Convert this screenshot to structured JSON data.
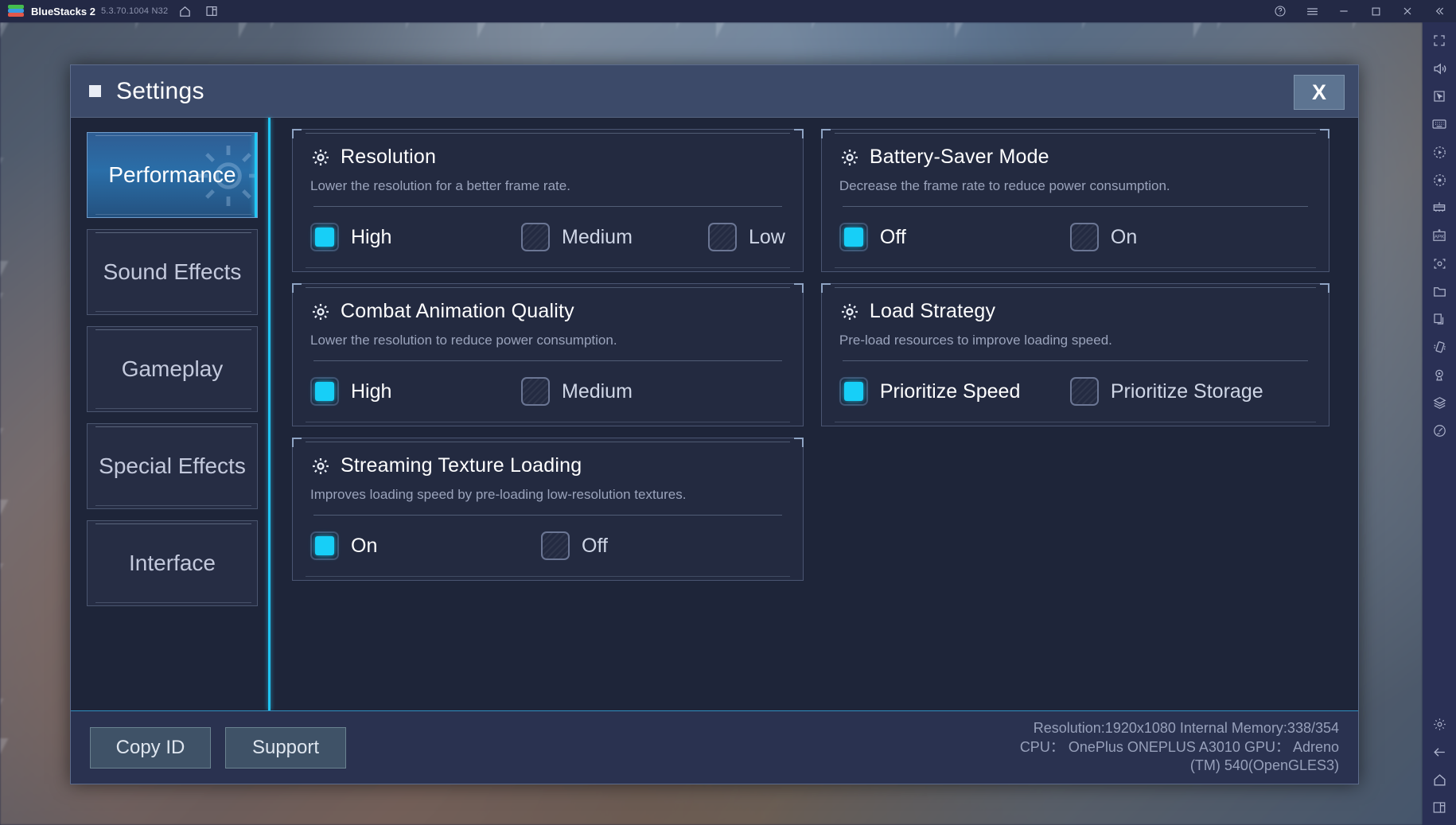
{
  "titlebar": {
    "app_name": "BlueStacks 2",
    "version": "5.3.70.1004 N32",
    "left_icons": [
      "home-icon",
      "recent-apps-icon"
    ],
    "right_icons": [
      "help-icon",
      "menu-icon",
      "minimize-icon",
      "maximize-icon",
      "close-icon",
      "collapse-icon"
    ]
  },
  "dialog": {
    "title": "Settings",
    "bullet_icon": "square-bullet-icon",
    "close_label": "X",
    "accent_color": "#17cff7",
    "sidebar": {
      "items": [
        {
          "label": "Performance",
          "active": true
        },
        {
          "label": "Sound Effects",
          "active": false
        },
        {
          "label": "Gameplay",
          "active": false
        },
        {
          "label": "Special Effects",
          "active": false
        },
        {
          "label": "Interface",
          "active": false
        }
      ]
    },
    "cards": [
      {
        "title": "Resolution",
        "desc": "Lower the resolution for a better frame rate.",
        "options": [
          {
            "label": "High",
            "checked": true
          },
          {
            "label": "Medium",
            "checked": false
          },
          {
            "label": "Low",
            "checked": false
          }
        ]
      },
      {
        "title": "Battery-Saver Mode",
        "desc": "Decrease the frame rate to reduce power consumption.",
        "options": [
          {
            "label": "Off",
            "checked": true
          },
          {
            "label": "On",
            "checked": false
          }
        ]
      },
      {
        "title": "Combat Animation Quality",
        "desc": "Lower the resolution to reduce power consumption.",
        "options": [
          {
            "label": "High",
            "checked": true
          },
          {
            "label": "Medium",
            "checked": false
          }
        ]
      },
      {
        "title": "Load Strategy",
        "desc": "Pre-load resources to improve loading speed.",
        "options": [
          {
            "label": "Prioritize Speed",
            "checked": true
          },
          {
            "label": "Prioritize Storage",
            "checked": false
          }
        ]
      },
      {
        "title": "Streaming Texture Loading",
        "desc": "Improves loading speed by pre-loading low-resolution textures.",
        "options": [
          {
            "label": "On",
            "checked": true
          },
          {
            "label": "Off",
            "checked": false
          }
        ]
      }
    ],
    "footer": {
      "copy_id_label": "Copy ID",
      "support_label": "Support",
      "sysinfo_line1": "Resolution:1920x1080  Internal Memory:338/354",
      "sysinfo_line2": "CPU： OnePlus ONEPLUS A3010  GPU： Adreno",
      "sysinfo_line3": "(TM) 540(OpenGLES3)"
    }
  },
  "rail": {
    "icons": [
      "fullscreen-icon",
      "volume-icon",
      "cursor-icon",
      "keyboard-icon",
      "macro-play-icon",
      "macro-record-icon",
      "multi-instance-icon",
      "install-apk-icon",
      "screenshot-icon",
      "media-folder-icon",
      "copy-instance-icon",
      "shake-icon",
      "location-icon",
      "layers-icon",
      "tilt-icon"
    ],
    "bottom_icons": [
      "settings-gear-icon",
      "back-icon",
      "home-icon",
      "recent-apps-icon"
    ]
  }
}
